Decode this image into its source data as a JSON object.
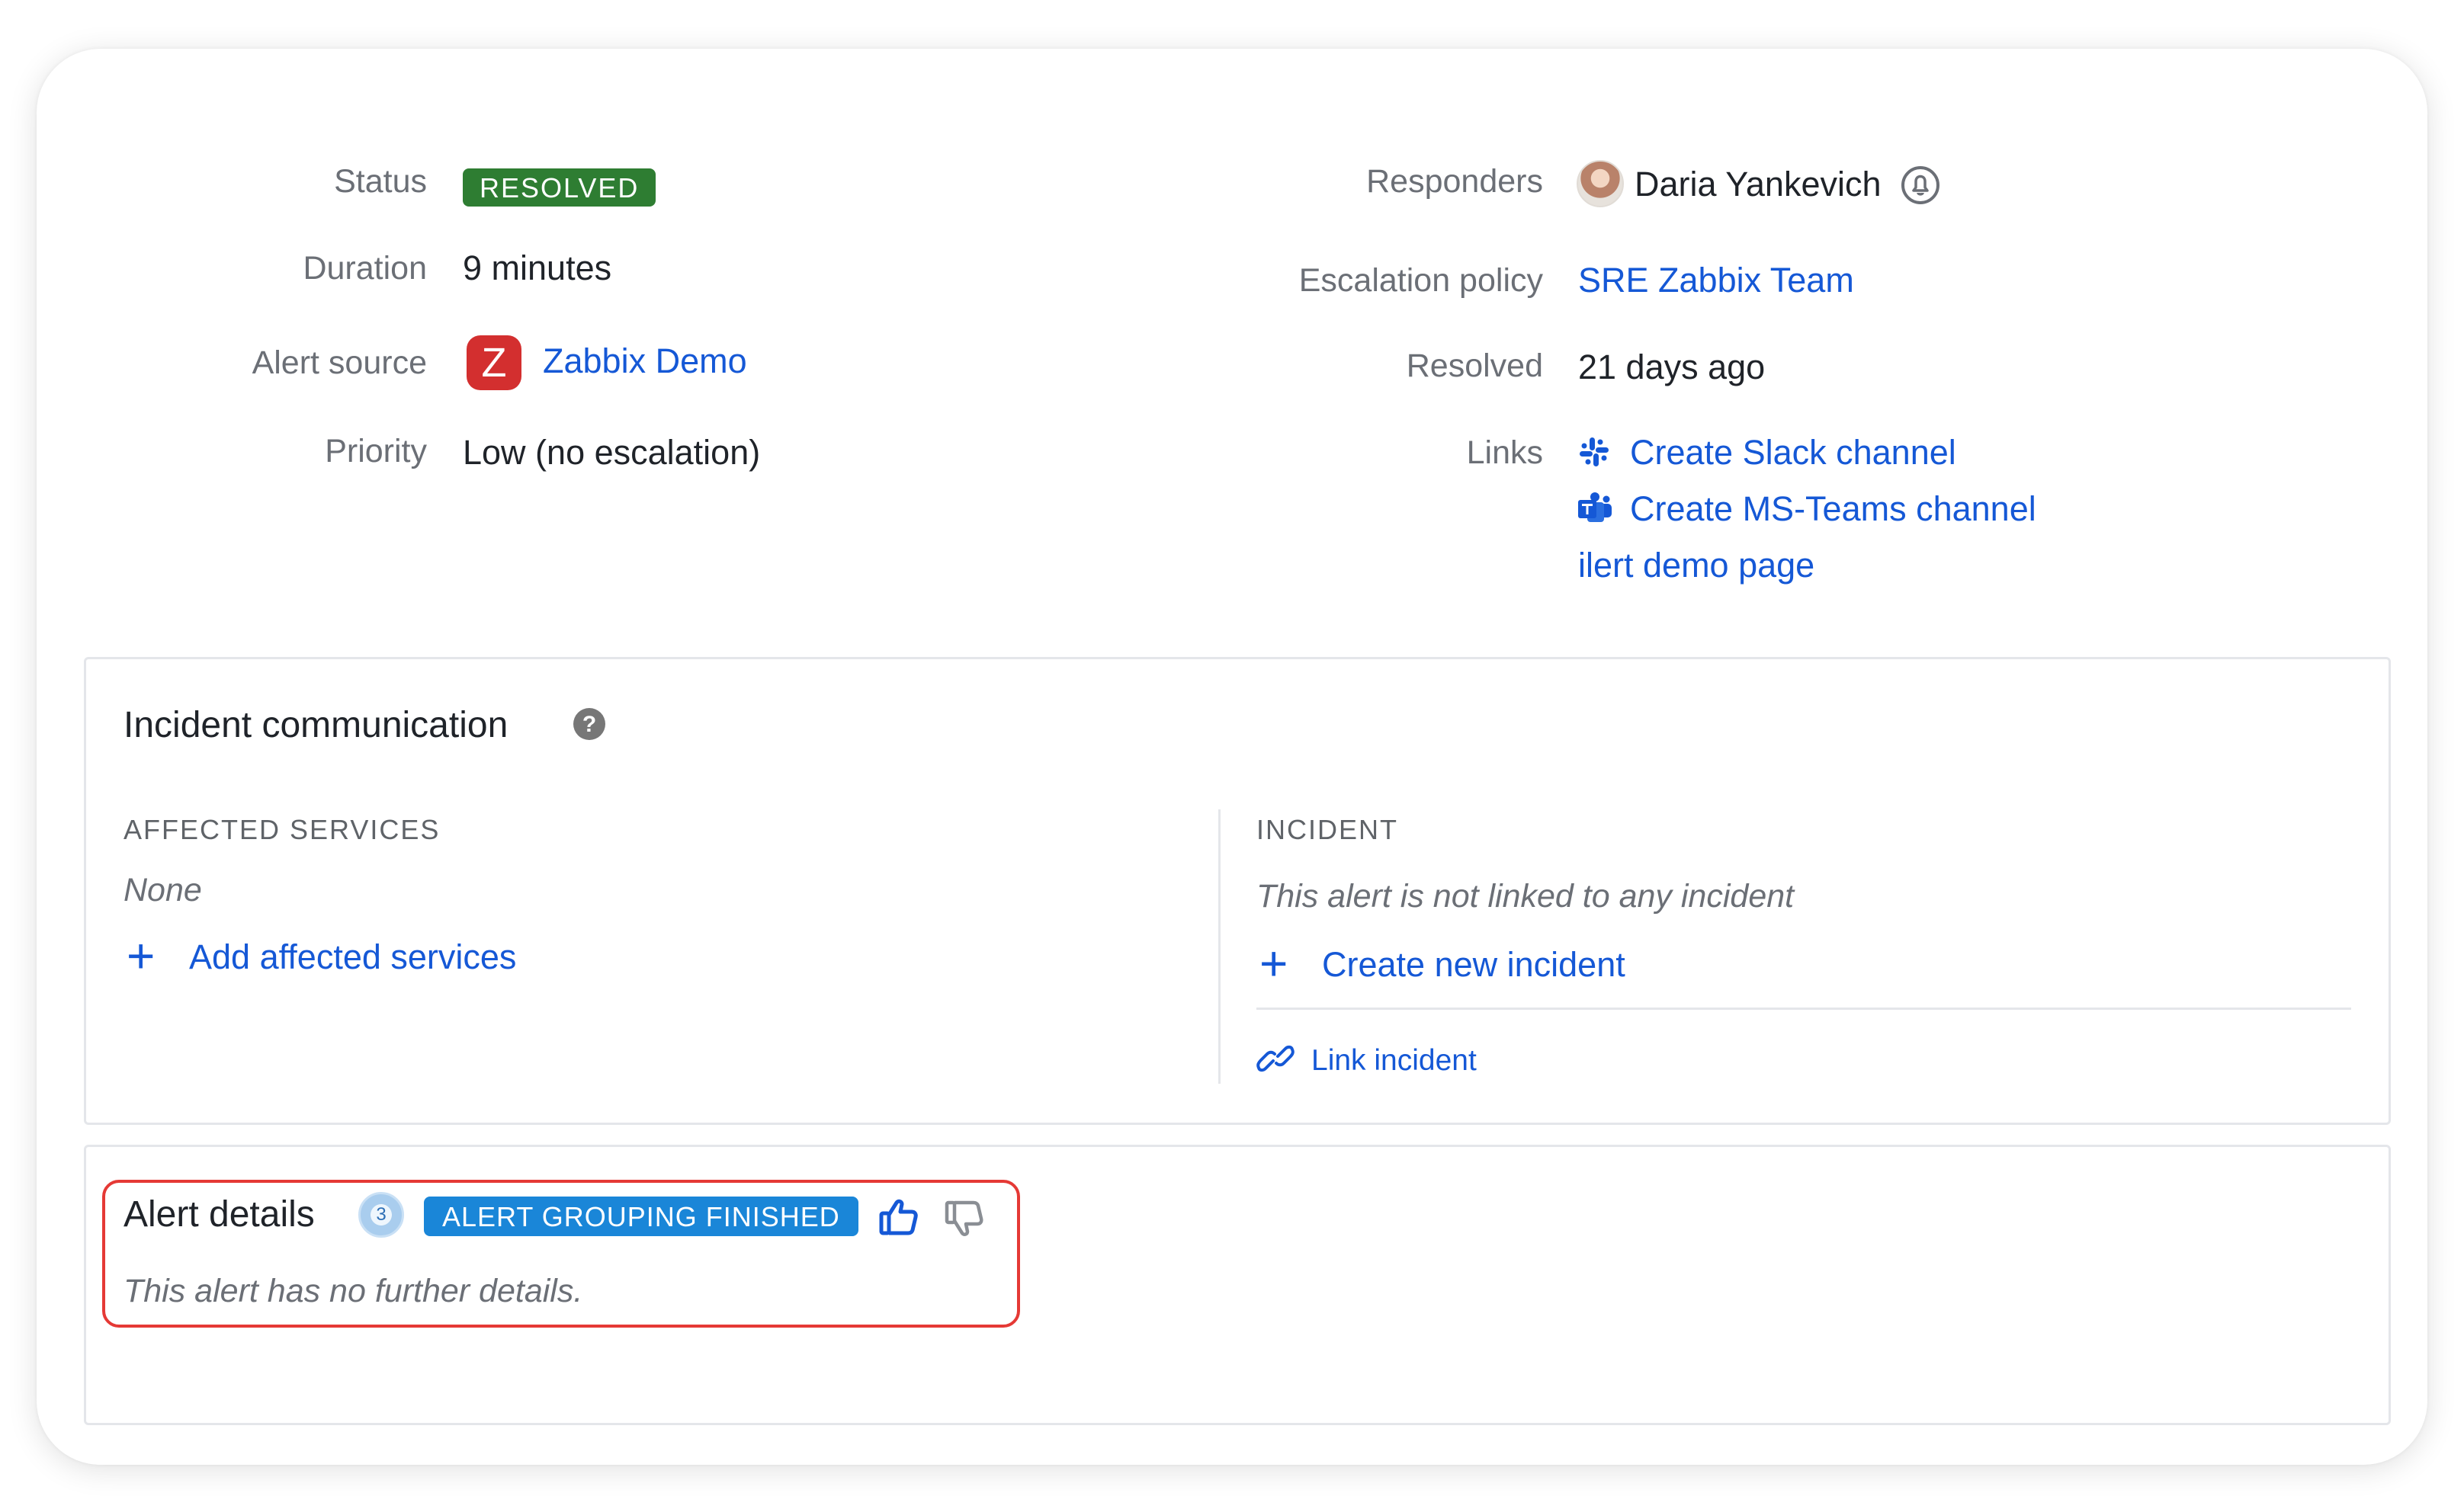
{
  "summary_left": {
    "status_label": "Status",
    "status_value": "RESOLVED",
    "duration_label": "Duration",
    "duration_value": "9 minutes",
    "alert_source_label": "Alert source",
    "alert_source_icon_letter": "Z",
    "alert_source_value": "Zabbix Demo",
    "priority_label": "Priority",
    "priority_value": "Low (no escalation)"
  },
  "summary_right": {
    "responders_label": "Responders",
    "responder_name": "Daria Yankevich",
    "escalation_label": "Escalation policy",
    "escalation_value": "SRE Zabbix Team",
    "resolved_label": "Resolved",
    "resolved_value": "21 days ago",
    "links_label": "Links",
    "links": [
      {
        "label": "Create Slack channel",
        "icon": "slack-icon"
      },
      {
        "label": "Create MS-Teams channel",
        "icon": "ms-teams-icon"
      },
      {
        "label": "ilert demo page",
        "icon": ""
      }
    ]
  },
  "incident_communication": {
    "title": "Incident communication",
    "affected_services_heading": "AFFECTED SERVICES",
    "affected_services_value": "None",
    "add_affected_services": "Add affected services",
    "incident_heading": "INCIDENT",
    "incident_value": "This alert is not linked to any incident",
    "create_incident": "Create new incident",
    "link_incident": "Link incident"
  },
  "alert_details": {
    "title": "Alert details",
    "grouped_count": "3",
    "grouping_badge": "ALERT GROUPING FINISHED",
    "empty_text": "This alert has no further details."
  },
  "colors": {
    "link": "#1558d6",
    "resolved_badge": "#2e7d32",
    "grouping_badge": "#1a86d8",
    "zabbix_red": "#d32f2f",
    "highlight": "#e53935"
  }
}
